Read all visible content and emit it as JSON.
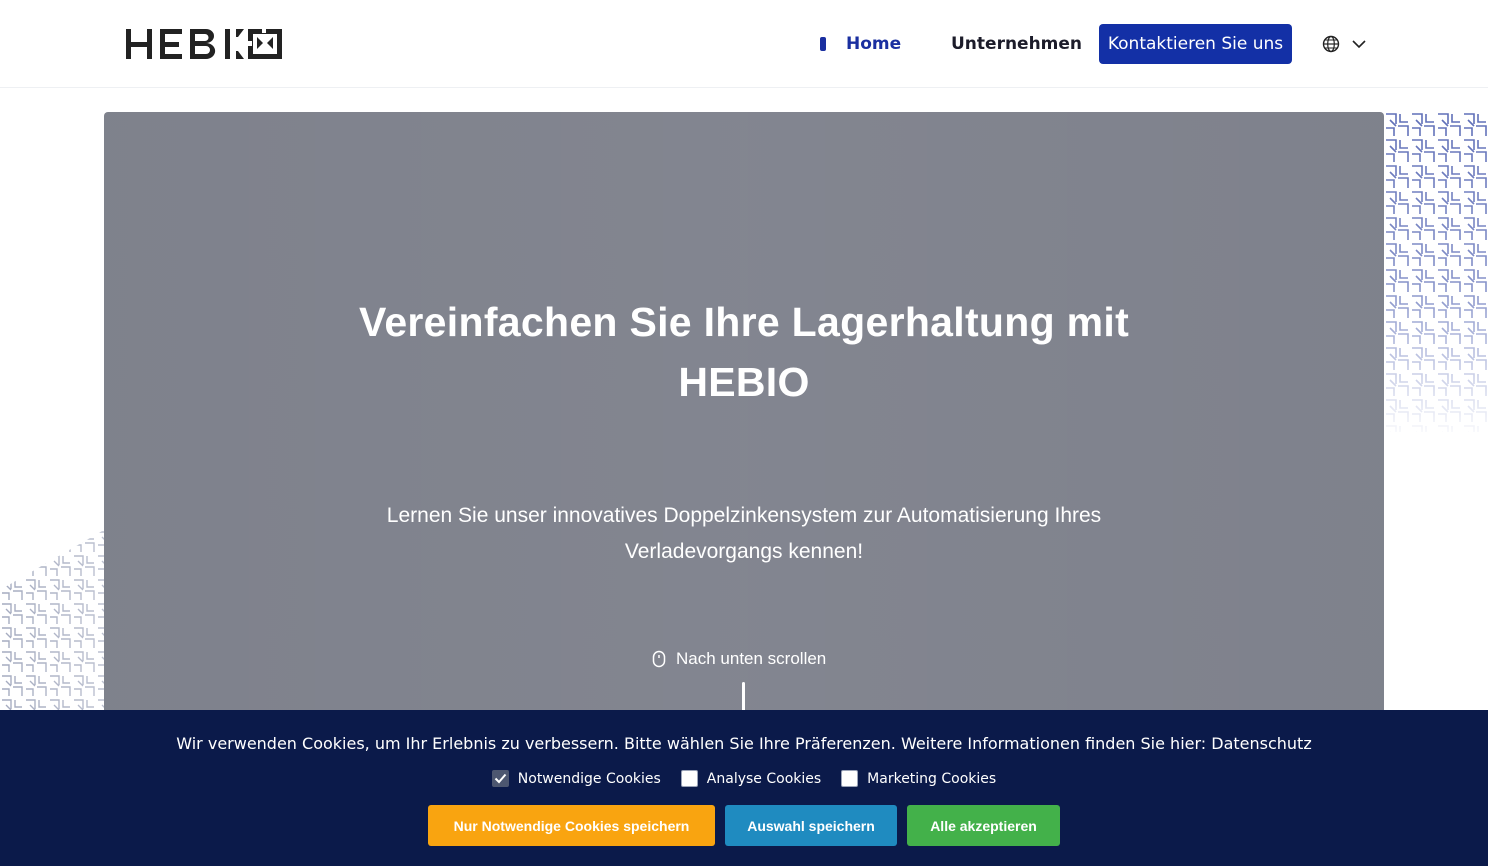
{
  "brand": {
    "logo_text": "HEBIO"
  },
  "nav": {
    "home": "Home",
    "company": "Unternehmen",
    "contact": "Kontaktieren Sie uns"
  },
  "hero": {
    "title": "Vereinfachen Sie Ihre Lagerhaltung mit HEBIO",
    "subtitle": "Lernen Sie unser innovatives Doppelzinkensystem zur Automatisierung Ihres Verladevorgangs kennen!",
    "scroll_label": "Nach unten scrollen"
  },
  "cookie": {
    "message": "Wir verwenden Cookies, um Ihr Erlebnis zu verbessern. Bitte wählen Sie Ihre Präferenzen. Weitere Informationen finden Sie hier: Datenschutz",
    "options": [
      {
        "label": "Notwendige Cookies",
        "checked": true
      },
      {
        "label": "Analyse Cookies",
        "checked": false
      },
      {
        "label": "Marketing Cookies",
        "checked": false
      }
    ],
    "buttons": {
      "necessary": "Nur Notwendige Cookies speichern",
      "selection": "Auswahl speichern",
      "all": "Alle akzeptieren"
    }
  },
  "colors": {
    "primary": "#1330a6",
    "hero_overlay": "#7c7f8a",
    "cookie_bg": "#0b1a4a",
    "btn_necessary": "#f9a410",
    "btn_selection": "#1f8bc0",
    "btn_all": "#43b14a"
  },
  "icons": [
    "globe-icon",
    "chevron-down-icon",
    "mouse-icon",
    "checkmark-icon"
  ]
}
